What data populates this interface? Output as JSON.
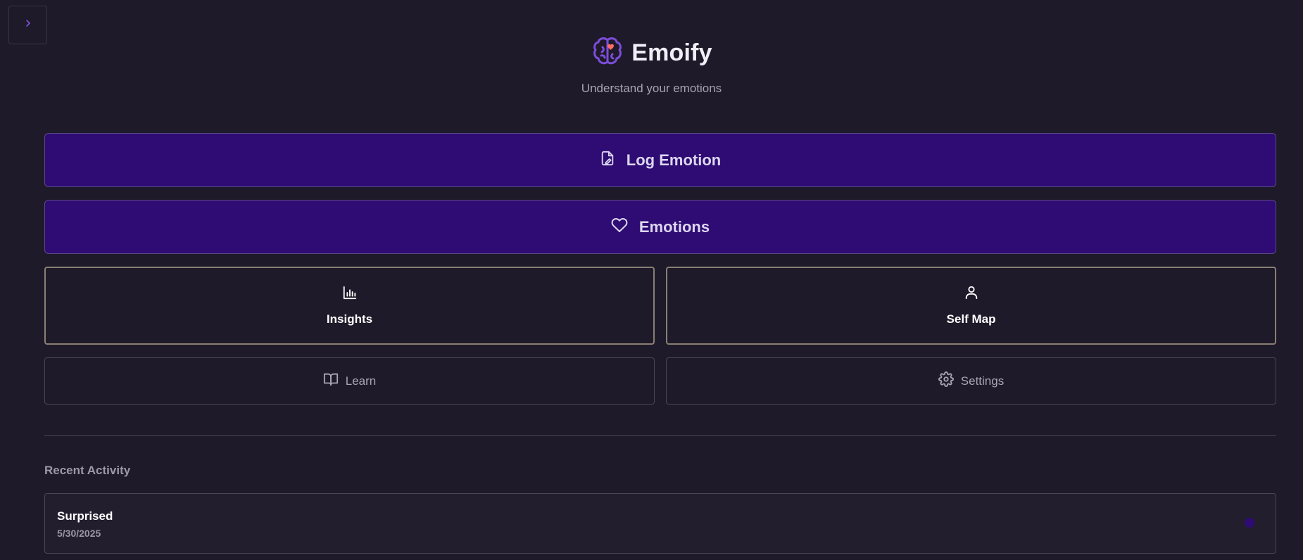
{
  "sidebar_toggle": {
    "icon": "chevron-right-icon"
  },
  "header": {
    "title": "Emoify",
    "tagline": "Understand your emotions",
    "logo_icon": "brain-heart-icon"
  },
  "actions": {
    "log_emotion": {
      "label": "Log Emotion",
      "icon": "file-edit-icon"
    },
    "emotions": {
      "label": "Emotions",
      "icon": "heart-icon"
    }
  },
  "cards": {
    "insights": {
      "label": "Insights",
      "icon": "bar-chart-icon"
    },
    "self_map": {
      "label": "Self Map",
      "icon": "user-icon"
    }
  },
  "secondary": {
    "learn": {
      "label": "Learn",
      "icon": "book-open-icon"
    },
    "settings": {
      "label": "Settings",
      "icon": "gear-icon"
    }
  },
  "recent": {
    "title": "Recent Activity",
    "items": [
      {
        "emotion": "Surprised",
        "date": "5/30/2025"
      }
    ]
  },
  "colors": {
    "background": "#1e1a29",
    "primary": "#2e0c74",
    "accent_purple": "#8b5cf6",
    "heart_accent": "#ff6b6b"
  }
}
